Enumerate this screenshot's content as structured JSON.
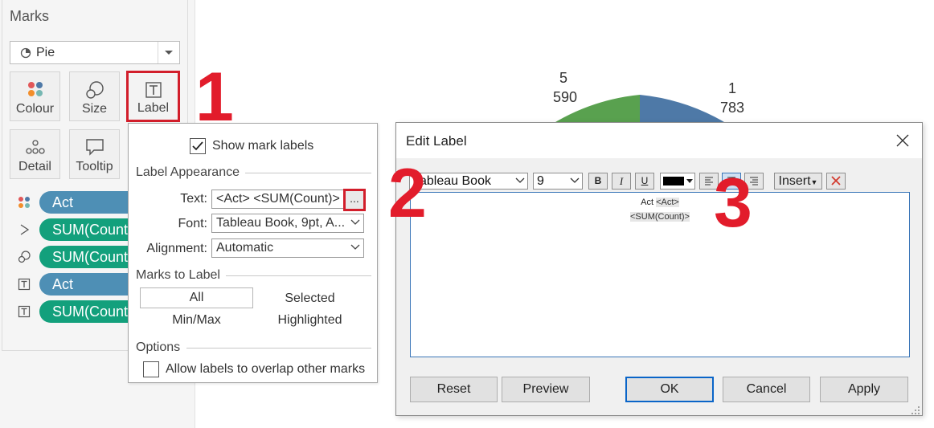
{
  "marks": {
    "title": "Marks",
    "mark_type": "Pie",
    "buttons": {
      "colour": "Colour",
      "size": "Size",
      "label": "Label",
      "detail": "Detail",
      "tooltip": "Tooltip"
    },
    "pills": [
      {
        "icon": "colour-icon",
        "text": "Act",
        "color": "#4e8fb5"
      },
      {
        "icon": "angle-icon",
        "text": "SUM(Count)",
        "color": "#13a07c"
      },
      {
        "icon": "size-icon",
        "text": "SUM(Count)",
        "color": "#13a07c"
      },
      {
        "icon": "label-icon",
        "text": "Act",
        "color": "#4e8fb5"
      },
      {
        "icon": "label-icon",
        "text": "SUM(Count)",
        "color": "#13a07c"
      }
    ]
  },
  "step_numbers": [
    "1",
    "2",
    "3"
  ],
  "pie": {
    "slices": [
      {
        "act": "5",
        "count": "590",
        "color": "#59a14f"
      },
      {
        "act": "1",
        "count": "783",
        "color": "#4e79a7"
      }
    ]
  },
  "label_popover": {
    "show_mark_labels": "Show mark labels",
    "show_mark_labels_checked": true,
    "appearance_title": "Label Appearance",
    "text_label": "Text:",
    "text_value": "<Act> <SUM(Count)>",
    "ellipsis": "...",
    "font_label": "Font:",
    "font_value": "Tableau Book, 9pt, A...",
    "alignment_label": "Alignment:",
    "alignment_value": "Automatic",
    "marks_to_label_title": "Marks to Label",
    "opt_all": "All",
    "opt_selected": "Selected",
    "opt_minmax": "Min/Max",
    "opt_highlighted": "Highlighted",
    "options_title": "Options",
    "allow_overlap": "Allow labels to overlap other marks",
    "allow_overlap_checked": false
  },
  "edit_label": {
    "title": "Edit Label",
    "font": "Tableau Book",
    "size": "9",
    "bold": "B",
    "italic": "I",
    "underline": "U",
    "text_color": "#000000",
    "insert": "Insert",
    "line1_text": "Act ",
    "line1_token": "<Act>",
    "line2_token": "<SUM(Count)>",
    "reset": "Reset",
    "preview": "Preview",
    "ok": "OK",
    "cancel": "Cancel",
    "apply": "Apply"
  }
}
